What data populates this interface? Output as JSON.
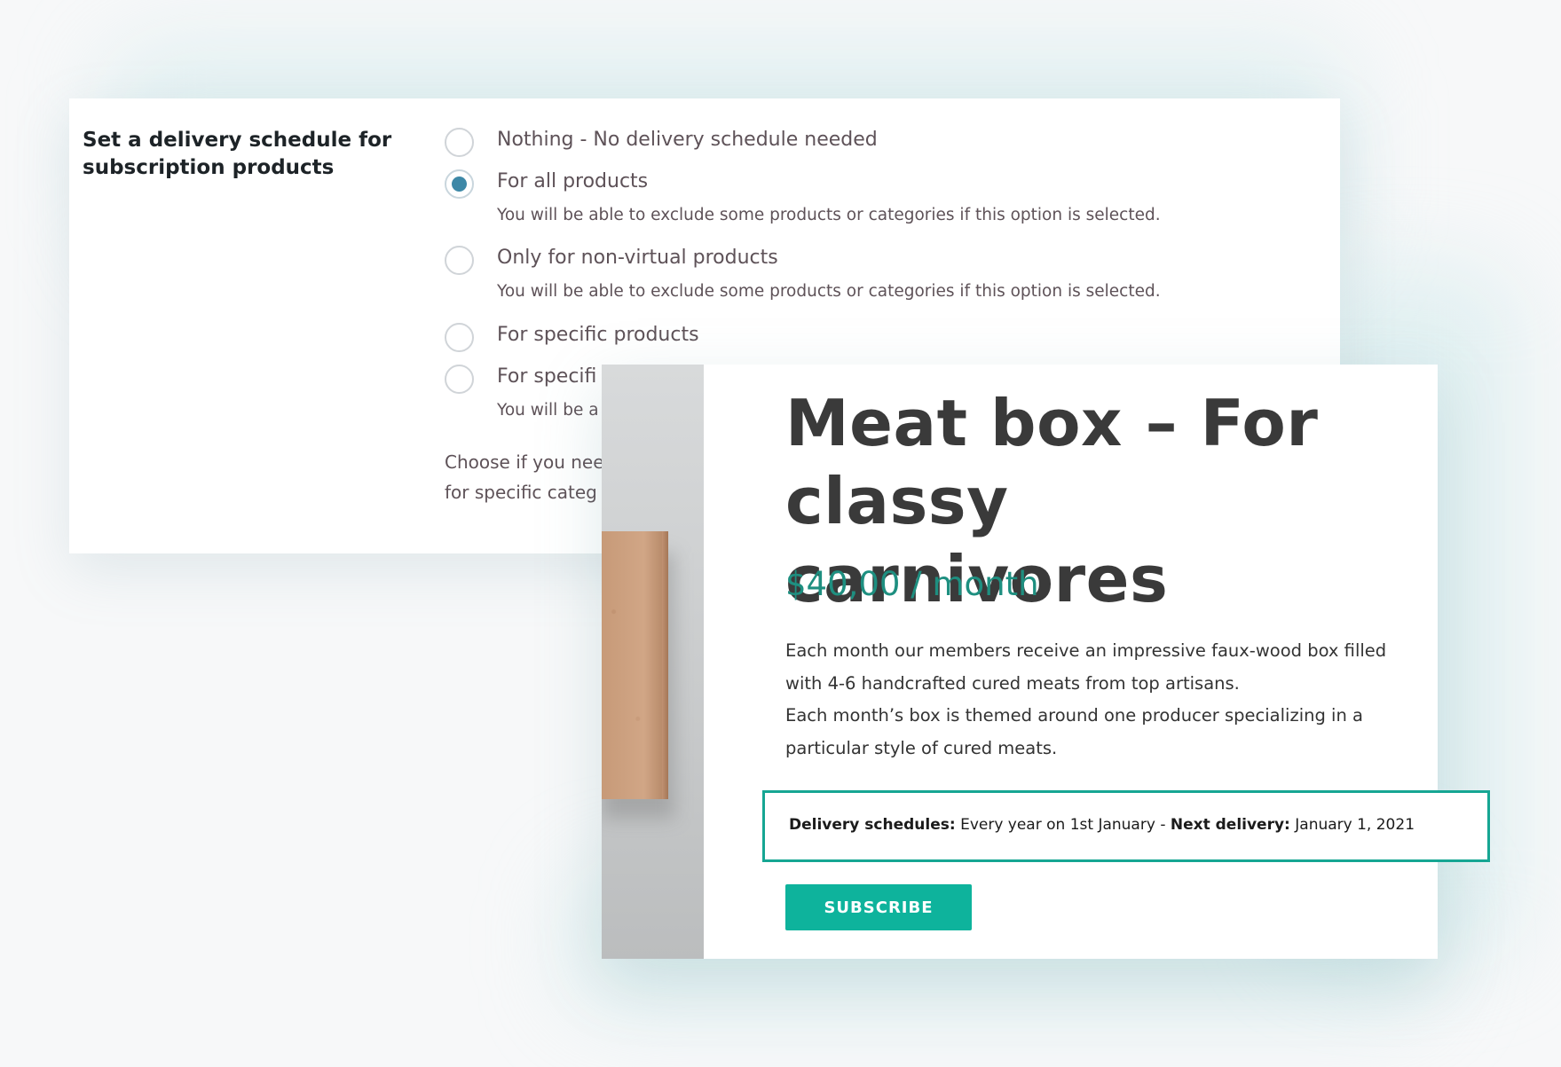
{
  "settings": {
    "label": "Set a delivery schedule for subscription products",
    "options": [
      {
        "label": "Nothing - No delivery schedule needed",
        "checked": false
      },
      {
        "label": "For all products",
        "description": "You will be able to exclude some products or categories if this option is selected.",
        "checked": true
      },
      {
        "label": "Only for non-virtual products",
        "description": "You will be able to exclude some products or categories if this option is selected.",
        "checked": false
      },
      {
        "label": "For specific products",
        "checked": false
      },
      {
        "label": "For specifi",
        "description": "You will be a",
        "checked": false
      }
    ],
    "help_line1": "Choose if you nee",
    "help_line2": "for specific categ"
  },
  "product": {
    "title": "Meat box – For classy carnivores",
    "price": "$40,00 / month",
    "description": [
      "Each month our members receive an impressive faux-wood box filled with 4-6 handcrafted cured meats from top artisans.",
      "Each month’s box is themed around one producer specializing in a particular style of cured meats."
    ],
    "delivery": {
      "schedule_label": "Delivery schedules:",
      "schedule_value": "Every year on 1st January",
      "separator": "-",
      "next_label": "Next delivery:",
      "next_value": "January 1, 2021"
    },
    "subscribe_label": "SUBSCRIBE"
  },
  "colors": {
    "accent": "#0eb39c",
    "price": "#1e8f80",
    "radio_selected": "#3d88a7",
    "highlight_border": "#16a693"
  }
}
